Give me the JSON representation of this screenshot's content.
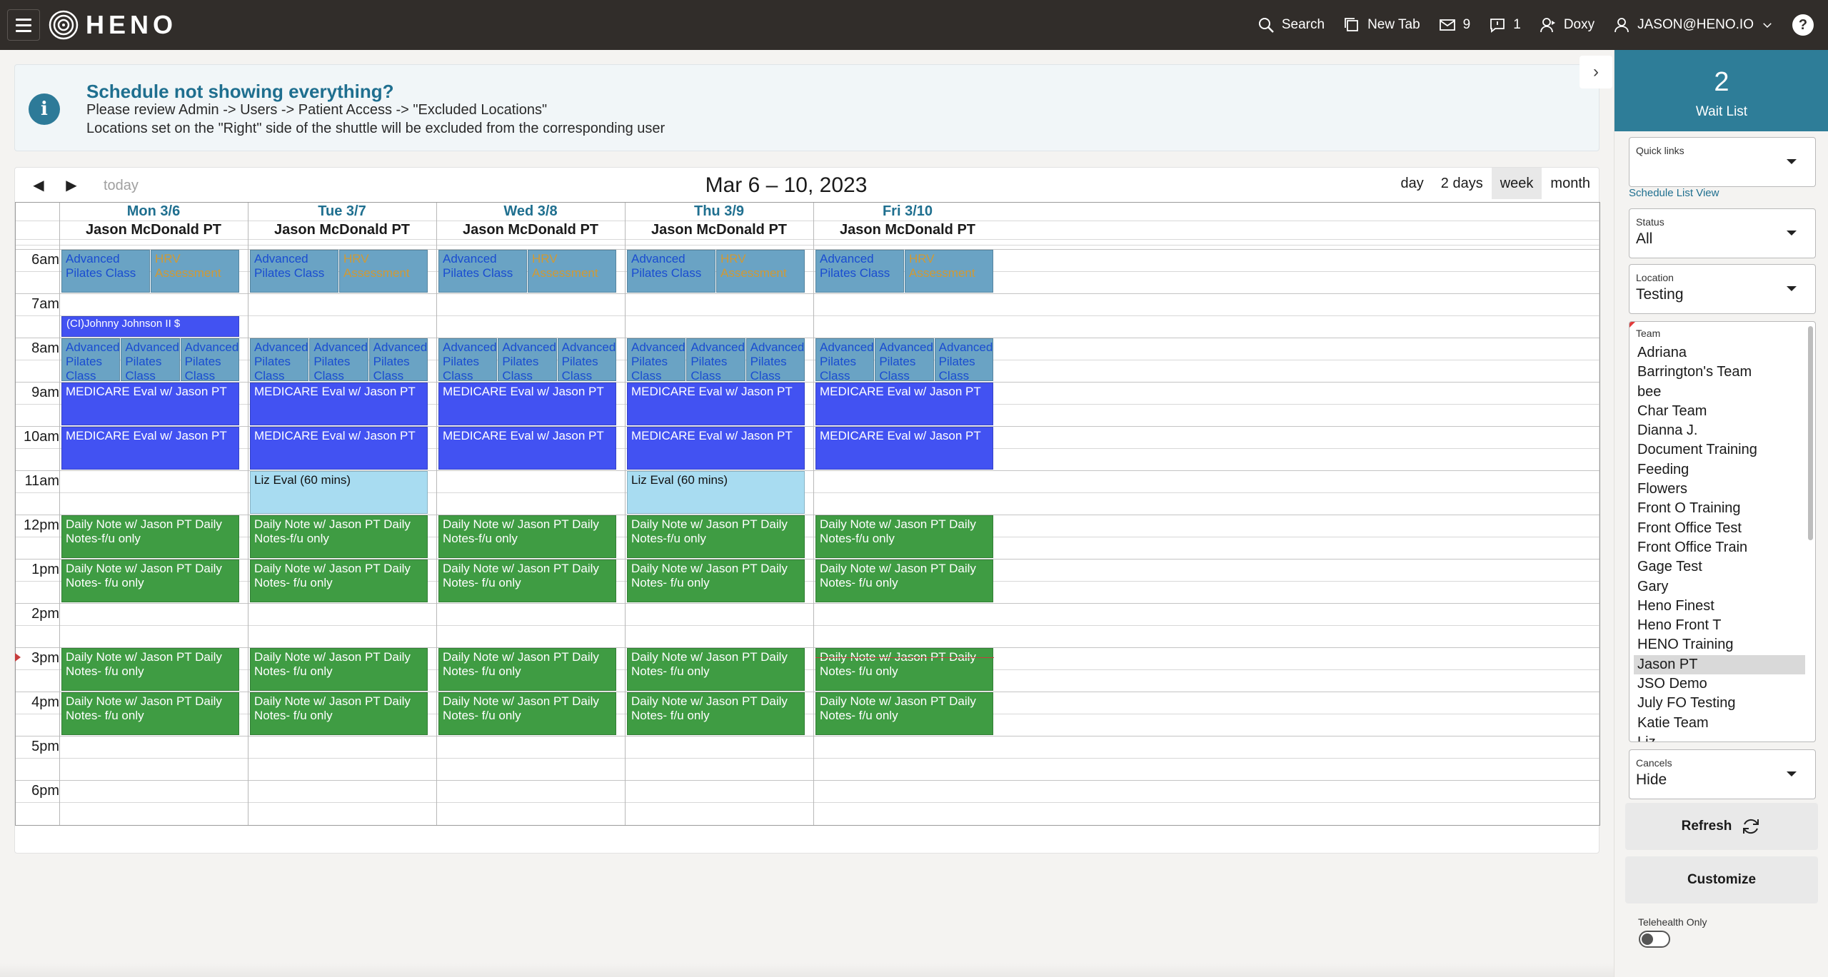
{
  "topbar": {
    "brand": "HENO",
    "actions": {
      "search": "Search",
      "new_tab": "New Tab",
      "mail_count": "9",
      "chat_count": "1",
      "doxy": "Doxy",
      "user": "JASON@HENO.IO"
    },
    "help": "?"
  },
  "banner": {
    "title": "Schedule not showing everything?",
    "line1": "Please review Admin -> Users -> Patient Access -> \"Excluded Locations\"",
    "line2": "Locations set on the \"Right\" side of the shuttle will be excluded from the corresponding user"
  },
  "calendar": {
    "title": "Mar 6 – 10, 2023",
    "today": "today",
    "views": [
      "day",
      "2 days",
      "week",
      "month"
    ],
    "active_view": "week",
    "days": [
      "Mon 3/6",
      "Tue 3/7",
      "Wed 3/8",
      "Thu 3/9",
      "Fri 3/10"
    ],
    "provider": "Jason McDonald PT",
    "times": [
      "6am",
      "7am",
      "8am",
      "9am",
      "10am",
      "11am",
      "12pm",
      "1pm",
      "2pm",
      "3pm",
      "4pm",
      "5pm",
      "6pm"
    ],
    "events": {
      "pilates": "Advanced Pilates Class",
      "hrv": "HRV Assessment",
      "johnny": "(CI)Johnny Johnson II  $",
      "medicare": "MEDICARE Eval w/ Jason PT",
      "liz": "Liz Eval (60 mins)",
      "daily_12": "Daily Note w/ Jason PT Daily Notes-f/u only",
      "daily": "Daily Note w/ Jason PT Daily Notes- f/u only"
    }
  },
  "panel": {
    "waitlist_count": "2",
    "waitlist_label": "Wait List",
    "quick_links_label": "Quick links",
    "schedule_list_link": "Schedule List View",
    "status_label": "Status",
    "status_value": "All",
    "location_label": "Location",
    "location_value": "Testing",
    "team_label": "Team",
    "teams": [
      "Adriana",
      "Barrington's Team",
      "bee",
      "Char Team",
      "Dianna J.",
      "Document Training",
      "Feeding",
      "Flowers",
      "Front O Training",
      "Front Office Test",
      "Front Office Train",
      "Gage Test",
      "Gary",
      "Heno Finest",
      "Heno Front T",
      "HENO Training",
      "Jason PT",
      "JSO Demo",
      "July FO Testing",
      "Katie Team",
      "Liz"
    ],
    "selected_team": "Jason PT",
    "cancels_label": "Cancels",
    "cancels_value": "Hide",
    "refresh_label": "Refresh",
    "customize_label": "Customize",
    "telehealth_label": "Telehealth Only"
  },
  "colors": {
    "topbar": "#312d2a",
    "accent": "#2e7d98",
    "pilates": "#6aa3c4",
    "medicare": "#4252f2",
    "liz": "#a8dcf1",
    "daily": "#3f9c43"
  }
}
